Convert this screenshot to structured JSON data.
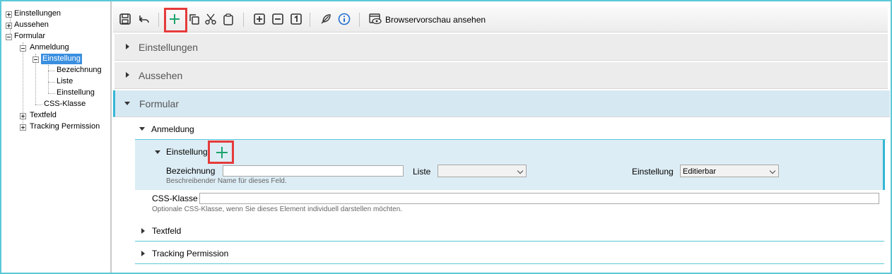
{
  "tree": {
    "items": [
      {
        "label": "Einstellungen"
      },
      {
        "label": "Aussehen"
      },
      {
        "label": "Formular"
      },
      {
        "label": "Anmeldung"
      },
      {
        "label": "Einstellung"
      },
      {
        "label": "Bezeichnung"
      },
      {
        "label": "Liste"
      },
      {
        "label": "Einstellung"
      },
      {
        "label": "CSS-Klasse"
      },
      {
        "label": "Textfeld"
      },
      {
        "label": "Tracking Permission"
      }
    ]
  },
  "toolbar": {
    "preview_label": "Browservorschau ansehen",
    "accent_add": "#1aa36b",
    "info_color": "#1f6fd1",
    "highlight_color": "#e53b3b"
  },
  "sections": {
    "einstellungen": "Einstellungen",
    "aussehen": "Aussehen",
    "formular": "Formular"
  },
  "formular": {
    "anmeldung": "Anmeldung",
    "einstellung": "Einstellung",
    "bezeichnung_label": "Bezeichnung",
    "bezeichnung_value": "",
    "bezeichnung_hint": "Beschreibender Name für dieses Feld.",
    "liste_label": "Liste",
    "liste_value": "",
    "einstellung_label": "Einstellung",
    "einstellung_value": "Editierbar",
    "css_label": "CSS-Klasse",
    "css_value": "",
    "css_hint": "Optionale CSS-Klasse, wenn Sie dieses Element individuell darstellen möchten.",
    "textfeld": "Textfeld",
    "tracking": "Tracking Permission"
  }
}
